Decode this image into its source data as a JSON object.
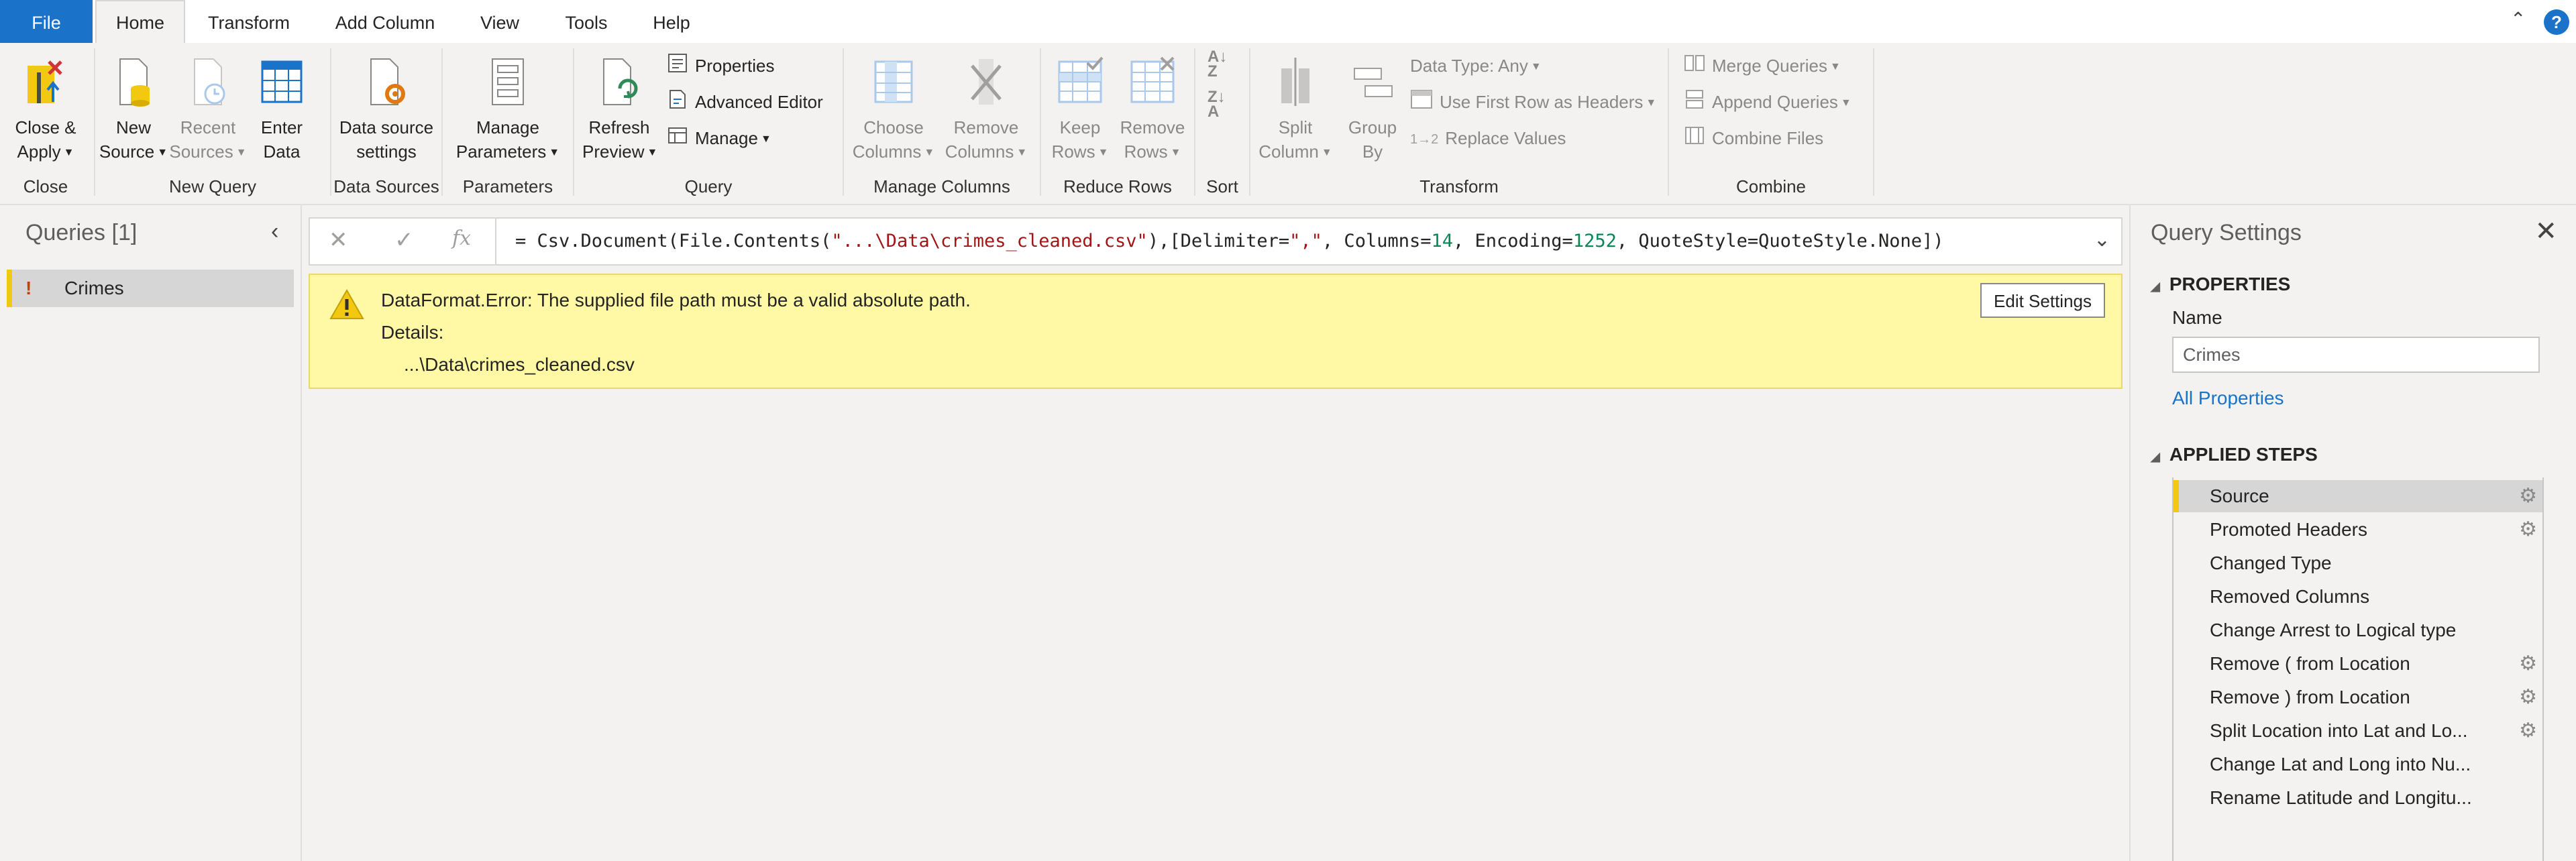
{
  "tabs": {
    "file": "File",
    "home": "Home",
    "transform": "Transform",
    "add_column": "Add Column",
    "view": "View",
    "tools": "Tools",
    "help": "Help",
    "help_icon": "?"
  },
  "ribbon": {
    "close": {
      "btn_line1": "Close &",
      "btn_line2": "Apply",
      "label": "Close"
    },
    "new_query": {
      "new_source_1": "New",
      "new_source_2": "Source",
      "recent_1": "Recent",
      "recent_2": "Sources",
      "enter_1": "Enter",
      "enter_2": "Data",
      "label": "New Query"
    },
    "data_sources": {
      "btn_1": "Data source",
      "btn_2": "settings",
      "label": "Data Sources"
    },
    "parameters": {
      "btn_1": "Manage",
      "btn_2": "Parameters",
      "label": "Parameters"
    },
    "query": {
      "refresh_1": "Refresh",
      "refresh_2": "Preview",
      "properties": "Properties",
      "advanced_editor": "Advanced Editor",
      "manage": "Manage",
      "label": "Query"
    },
    "manage_columns": {
      "choose_1": "Choose",
      "choose_2": "Columns",
      "remove_1": "Remove",
      "remove_2": "Columns",
      "label": "Manage Columns"
    },
    "reduce_rows": {
      "keep_1": "Keep",
      "keep_2": "Rows",
      "remove_1": "Remove",
      "remove_2": "Rows",
      "label": "Reduce Rows"
    },
    "sort": {
      "label": "Sort"
    },
    "transform": {
      "split_1": "Split",
      "split_2": "Column",
      "group_1": "Group",
      "group_2": "By",
      "data_type": "Data Type: Any",
      "first_row": "Use First Row as Headers",
      "replace": "Replace Values",
      "label": "Transform"
    },
    "combine": {
      "merge": "Merge Queries",
      "append": "Append Queries",
      "combine_files": "Combine Files",
      "label": "Combine"
    }
  },
  "queries_pane": {
    "title": "Queries [1]",
    "items": [
      {
        "name": "Crimes",
        "warning": "!"
      }
    ]
  },
  "formula_bar": {
    "fx": "fx",
    "prefix": "= Csv.Document(File.Contents(",
    "path_str": "\"...\\Data\\crimes_cleaned.csv\"",
    "mid1": "),[Delimiter=",
    "delim_str": "\",\"",
    "mid2": ", Columns=",
    "columns_num": "14",
    "mid3": ", Encoding=",
    "encoding_num": "1252",
    "suffix": ", QuoteStyle=QuoteStyle.None])"
  },
  "error": {
    "message": "DataFormat.Error: The supplied file path must be a valid absolute path.",
    "details_label": "Details:",
    "path": "...\\Data\\crimes_cleaned.csv",
    "edit_button": "Edit Settings"
  },
  "query_settings": {
    "title": "Query Settings",
    "properties_header": "PROPERTIES",
    "name_label": "Name",
    "name_value": "Crimes",
    "all_properties": "All Properties",
    "applied_steps_header": "APPLIED STEPS",
    "steps": [
      {
        "label": "Source",
        "gear": true
      },
      {
        "label": "Promoted Headers",
        "gear": true
      },
      {
        "label": "Changed Type",
        "gear": false
      },
      {
        "label": "Removed Columns",
        "gear": false
      },
      {
        "label": "Change Arrest to Logical type",
        "gear": false
      },
      {
        "label": "Remove ( from Location",
        "gear": true
      },
      {
        "label": "Remove ) from Location",
        "gear": true
      },
      {
        "label": "Split Location into Lat and Lo...",
        "gear": true
      },
      {
        "label": "Change Lat and Long into Nu...",
        "gear": false
      },
      {
        "label": "Rename Latitude and Longitu...",
        "gear": false
      }
    ]
  },
  "colors": {
    "accent": "#1a73c8",
    "warning_yellow": "#fff9a6",
    "selection_bar": "#f2c811"
  }
}
